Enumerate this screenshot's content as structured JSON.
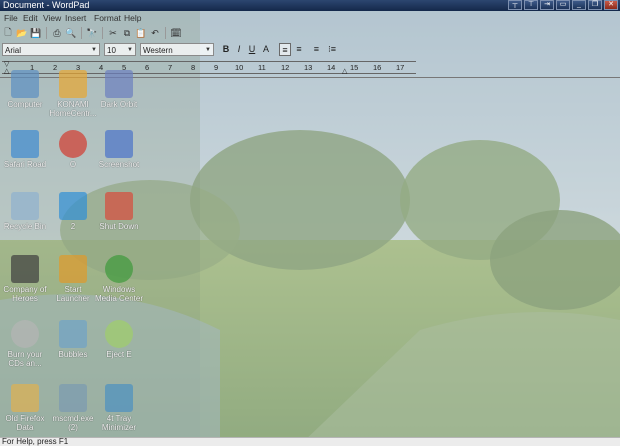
{
  "window": {
    "title": "Document - WordPad"
  },
  "menu": [
    "File",
    "Edit",
    "View",
    "Insert",
    "Format",
    "Help"
  ],
  "toolbar": [
    {
      "name": "new-icon",
      "glyph": "🗋"
    },
    {
      "name": "open-icon",
      "glyph": "📂"
    },
    {
      "name": "save-icon",
      "glyph": "💾"
    },
    {
      "name": "print-icon",
      "glyph": "⎙"
    },
    {
      "name": "print-preview-icon",
      "glyph": "🔍"
    },
    {
      "name": "find-icon",
      "glyph": "🔭"
    },
    {
      "name": "cut-icon",
      "glyph": "✂"
    },
    {
      "name": "copy-icon",
      "glyph": "⧉"
    },
    {
      "name": "paste-icon",
      "glyph": "📋"
    },
    {
      "name": "undo-icon",
      "glyph": "↶"
    },
    {
      "name": "insert-datetime-icon",
      "glyph": "🗓"
    }
  ],
  "format": {
    "font": "Arial",
    "size": "10",
    "script": "Western",
    "bold": "B",
    "italic": "I",
    "underline": "U",
    "color": "A",
    "align_left": "≡",
    "align_center": "≡",
    "align_right": "≡",
    "bullets": "⁝≡"
  },
  "ruler": [
    "1",
    "2",
    "3",
    "4",
    "5",
    "6",
    "7",
    "8",
    "9",
    "10",
    "11",
    "12",
    "13",
    "14",
    "15",
    "16",
    "17"
  ],
  "desktop_icons": [
    {
      "label": "Computer",
      "color": "#5b8fc2"
    },
    {
      "label": "KONAMI HomeCentr...",
      "color": "#e8a630"
    },
    {
      "label": "Dark Orbit",
      "color": "#6b7fbf"
    },
    {
      "label": "Safari Road",
      "color": "#3f8ad0"
    },
    {
      "label": "O",
      "color": "#d33a2f"
    },
    {
      "label": "Screenshot",
      "color": "#4a72c9"
    },
    {
      "label": "Recycle Bin",
      "color": "#8fb0cf"
    },
    {
      "label": "2",
      "color": "#2f8fd6"
    },
    {
      "label": "Shut Down",
      "color": "#d94a3a"
    },
    {
      "label": "Company of Heroes",
      "color": "#3d3d3d"
    },
    {
      "label": "Start Launcher",
      "color": "#e09a2a"
    },
    {
      "label": "Windows Media Center",
      "color": "#3d9a3a"
    },
    {
      "label": "Burn your CDs an...",
      "color": "#b5b5b5"
    },
    {
      "label": "Bubbles",
      "color": "#6fa3c8"
    },
    {
      "label": "Eject E",
      "color": "#9fcf6a"
    },
    {
      "label": "Old Firefox Data",
      "color": "#e0b050"
    },
    {
      "label": "mscmd.exe (2)",
      "color": "#7a9ab0"
    },
    {
      "label": "4t Tray Minimizer",
      "color": "#4b90c0"
    }
  ],
  "status": "For Help, press F1"
}
